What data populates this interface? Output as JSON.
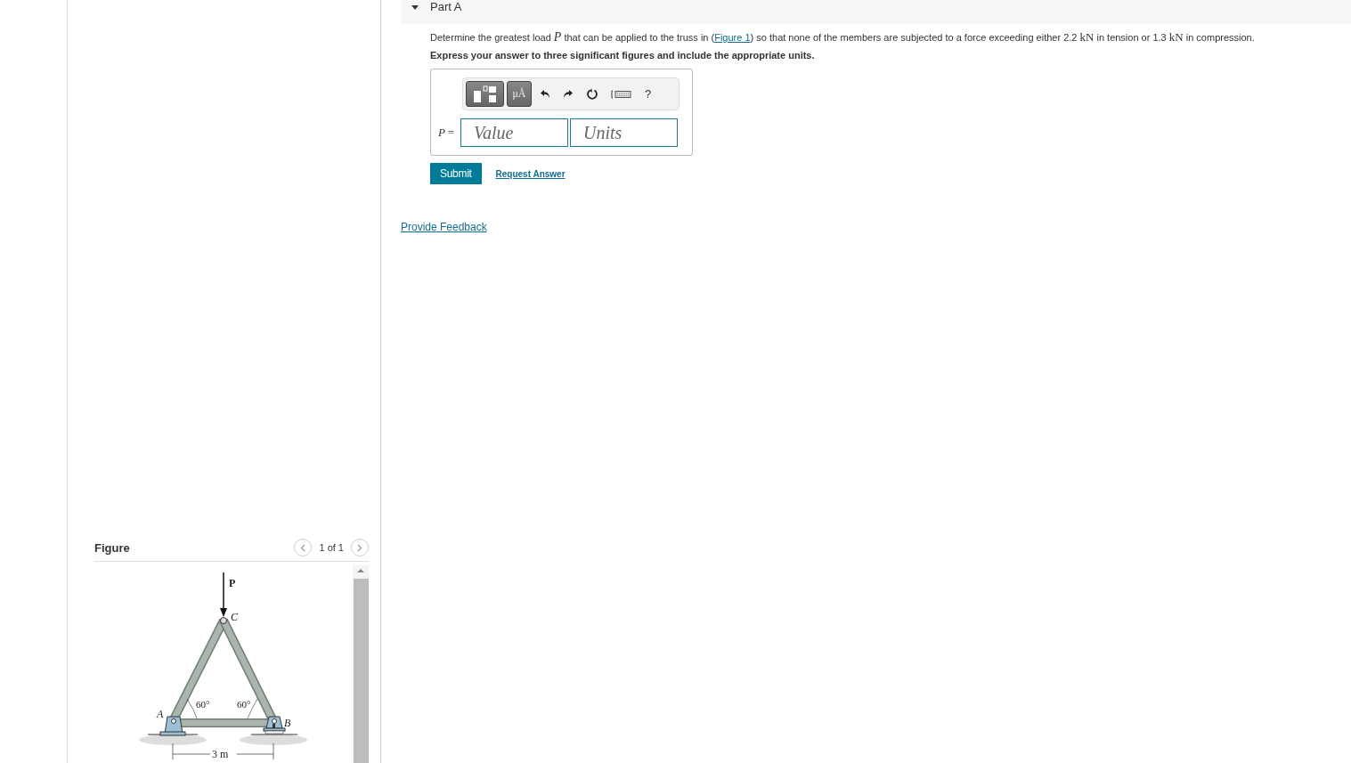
{
  "part": {
    "title": "Part A",
    "expanded": true
  },
  "prompt": [
    {
      "kind": "text",
      "text": "Determine the greatest load "
    },
    {
      "kind": "math",
      "text": "P"
    },
    {
      "kind": "text",
      "text": " that can be applied to the truss in ("
    },
    {
      "kind": "link",
      "text": "Figure 1"
    },
    {
      "kind": "text",
      "text": ") so that none of the members are subjected to a force exceeding either 2.2 "
    },
    {
      "kind": "unit",
      "text": "kN"
    },
    {
      "kind": "text",
      "text": " in tension or 1.3 "
    },
    {
      "kind": "unit",
      "text": "kN"
    },
    {
      "kind": "text",
      "text": " in compression."
    }
  ],
  "instruction": "Express your answer to three significant figures and include the appropriate units.",
  "answer": {
    "label": "*P* =",
    "value_placeholder": "Value",
    "units_placeholder": "Units",
    "toolbar": [
      {
        "kind": "templates"
      },
      {
        "kind": "units",
        "label": "μÅ"
      },
      {
        "kind": "undo"
      },
      {
        "kind": "redo"
      },
      {
        "kind": "reset"
      },
      {
        "kind": "keyboard"
      },
      {
        "kind": "help",
        "label": "?"
      }
    ]
  },
  "submit": "Submit",
  "request_answer": "Request Answer",
  "feedback": "Provide Feedback",
  "figure": {
    "title": "Figure",
    "pager": "1 of 1",
    "labels": [
      {
        "kind": "load",
        "text": "P"
      },
      {
        "kind": "point",
        "text": "C"
      },
      {
        "kind": "point",
        "text": "A"
      },
      {
        "kind": "point",
        "text": "B"
      },
      {
        "kind": "angle",
        "text": "60°"
      },
      {
        "kind": "angle",
        "text": "60°"
      },
      {
        "kind": "dimension",
        "text": "3 m"
      }
    ]
  }
}
